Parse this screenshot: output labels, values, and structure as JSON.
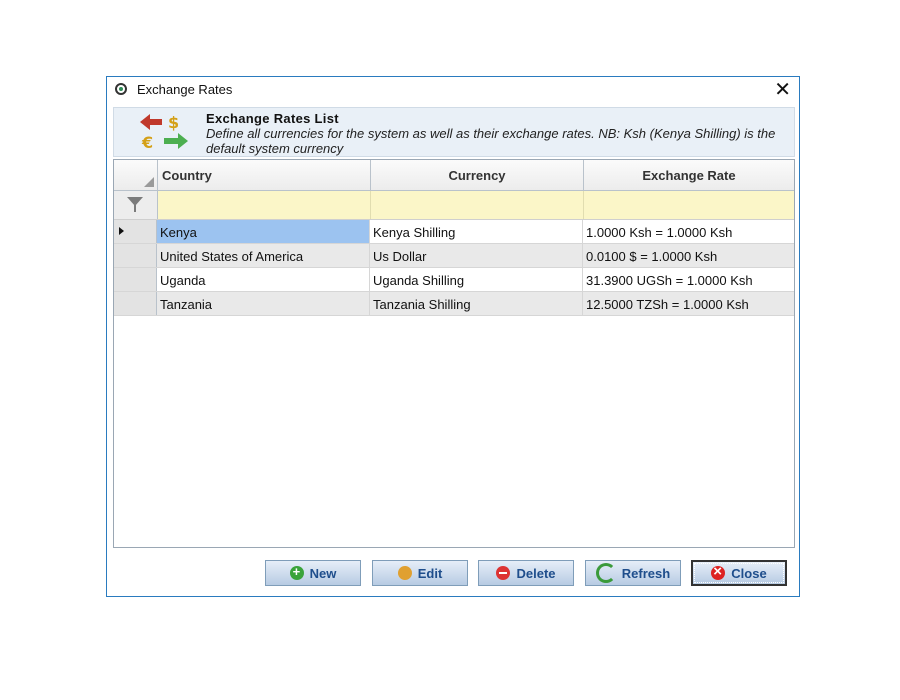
{
  "window": {
    "title": "Exchange Rates"
  },
  "header": {
    "title": "Exchange Rates List",
    "description": "Define all currencies for the system as well as their exchange rates. NB: Ksh (Kenya Shilling) is the default system currency"
  },
  "grid": {
    "columns": [
      "Country",
      "Currency",
      "Exchange Rate"
    ],
    "rows": [
      {
        "country": "Kenya",
        "currency": "Kenya Shilling",
        "rate": "1.0000 Ksh = 1.0000 Ksh"
      },
      {
        "country": "United States of America",
        "currency": "Us Dollar",
        "rate": "0.0100 $ = 1.0000 Ksh"
      },
      {
        "country": "Uganda",
        "currency": "Uganda Shilling",
        "rate": "31.3900 UGSh = 1.0000 Ksh"
      },
      {
        "country": "Tanzania",
        "currency": "Tanzania Shilling",
        "rate": "12.5000 TZSh = 1.0000 Ksh"
      }
    ]
  },
  "buttons": {
    "new": "New",
    "edit": "Edit",
    "delete": "Delete",
    "refresh": "Refresh",
    "close": "Close"
  },
  "icons": {
    "app": "app-gear-icon",
    "header": "currency-exchange-icon",
    "filter": "filter-icon",
    "new": "add-icon",
    "edit": "pencil-icon",
    "delete": "delete-icon",
    "refresh": "refresh-icon",
    "close": "close-icon"
  },
  "colors": {
    "window_border": "#2a7bbf",
    "filter_row": "#fbf6c8",
    "selected_cell": "#9cc3f0",
    "button_text": "#1f4e8c"
  }
}
